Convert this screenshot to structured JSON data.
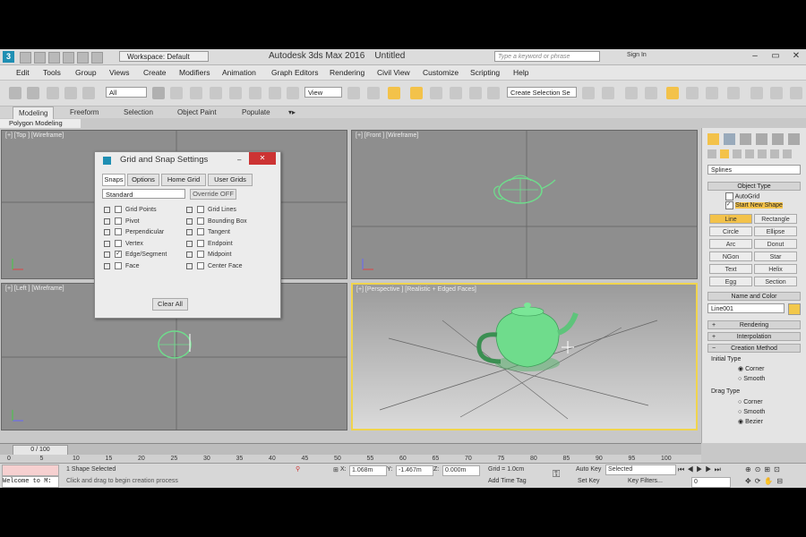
{
  "titlebar": {
    "workspace": "Workspace: Default",
    "app_title": "Autodesk 3ds Max 2016",
    "doc_title": "Untitled",
    "search_placeholder": "Type a keyword or phrase",
    "sign_in": "Sign In"
  },
  "menu": [
    "Edit",
    "Tools",
    "Group",
    "Views",
    "Create",
    "Modifiers",
    "Animation",
    "Graph Editors",
    "Rendering",
    "Civil View",
    "Customize",
    "Scripting",
    "Help"
  ],
  "toolbar": {
    "selection_filter": "All",
    "ref_coord": "View",
    "named_selection": "Create Selection Se"
  },
  "ribbon": {
    "tabs": [
      "Modeling",
      "Freeform",
      "Selection",
      "Object Paint",
      "Populate"
    ],
    "active": "Modeling",
    "sub": "Polygon Modeling"
  },
  "viewports": {
    "top": "[+] [Top ] [Wireframe]",
    "front": "[+] [Front ] [Wireframe]",
    "left": "[+] [Left ] [Wireframe]",
    "perspective": "[+] [Perspective ] [Realistic + Edged Faces]"
  },
  "dialog": {
    "title": "Grid and Snap Settings",
    "tabs": [
      "Snaps",
      "Options",
      "Home Grid",
      "User Grids"
    ],
    "active_tab": "Snaps",
    "dropdown": "Standard",
    "override": "Override OFF",
    "snaps_left": [
      {
        "label": "Grid Points",
        "checked": false
      },
      {
        "label": "Pivot",
        "checked": false
      },
      {
        "label": "Perpendicular",
        "checked": false
      },
      {
        "label": "Vertex",
        "checked": false
      },
      {
        "label": "Edge/Segment",
        "checked": true
      },
      {
        "label": "Face",
        "checked": false
      }
    ],
    "snaps_right": [
      {
        "label": "Grid Lines",
        "checked": false
      },
      {
        "label": "Bounding Box",
        "checked": false
      },
      {
        "label": "Tangent",
        "checked": false
      },
      {
        "label": "Endpoint",
        "checked": false
      },
      {
        "label": "Midpoint",
        "checked": false
      },
      {
        "label": "Center Face",
        "checked": false
      }
    ],
    "clear_all": "Clear All"
  },
  "command_panel": {
    "category": "Splines",
    "object_type_header": "Object Type",
    "autogrid": "AutoGrid",
    "start_new_shape": "Start New Shape",
    "shapes": [
      "Line",
      "Rectangle",
      "Circle",
      "Ellipse",
      "Arc",
      "Donut",
      "NGon",
      "Star",
      "Text",
      "Helix",
      "Egg",
      "Section"
    ],
    "active_shape": "Line",
    "name_color_header": "Name and Color",
    "object_name": "Line001",
    "object_color": "#f2c84b",
    "rollouts": [
      "Rendering",
      "Interpolation",
      "Creation Method"
    ],
    "initial_type_label": "Initial Type",
    "initial_type": [
      "Corner",
      "Smooth"
    ],
    "initial_selected": "Corner",
    "drag_type_label": "Drag Type",
    "drag_type": [
      "Corner",
      "Smooth",
      "Bezier"
    ],
    "drag_selected": "Bezier"
  },
  "timeline": {
    "frame": "0 / 100",
    "ticks": [
      "0",
      "5",
      "10",
      "15",
      "20",
      "25",
      "30",
      "35",
      "40",
      "45",
      "50",
      "55",
      "60",
      "65",
      "70",
      "75",
      "80",
      "85",
      "90",
      "95",
      "100"
    ]
  },
  "status": {
    "listener": "Welcome to M:",
    "selection": "1 Shape Selected",
    "prompt": "Click and drag to begin creation process",
    "x": "1.068m",
    "y": "-1.467m",
    "z": "0.000m",
    "grid": "Grid = 1.0cm",
    "auto_key": "Auto Key",
    "selected_dropdown": "Selected",
    "set_key": "Set Key",
    "key_filters": "Key Filters...",
    "add_time_tag": "Add Time Tag",
    "frame_field": "0"
  },
  "colors": {
    "teapot": "#6fdc8c",
    "active_viewport_border": "#f0d44d",
    "accent_highlight": "#f3c24a"
  }
}
